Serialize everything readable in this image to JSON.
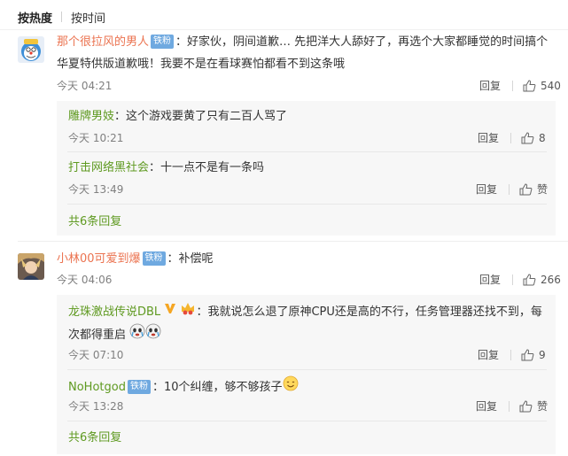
{
  "sort": {
    "hot": "按热度",
    "time": "按时间"
  },
  "comments": [
    {
      "user": "那个很拉风的男人",
      "badge": "铁粉",
      "text_line1": "：好家伙，阴间道歉… 先把洋大人舔好了，再选个大家都睡觉的时间搞个",
      "text_line2": "华夏特供版道歉哦！我要不是在看球赛怕都看不到这条哦",
      "time": "今天 04:21",
      "reply_label": "回复",
      "likes": "540",
      "replies": [
        {
          "user": "雕牌男妓",
          "text": "：这个游戏要黄了只有二百人骂了",
          "time": "今天 10:21",
          "reply_label": "回复",
          "likes": "8"
        },
        {
          "user": "打击网络黑社会",
          "text": "：十一点不是有一条吗",
          "time": "今天 13:49",
          "reply_label": "回复",
          "likes": "赞"
        }
      ],
      "more": "共6条回复"
    },
    {
      "user": "小林00可爱到爆",
      "badge": "铁粉",
      "text_line1": "：补偿呢",
      "time": "今天 04:06",
      "reply_label": "回复",
      "likes": "266",
      "replies": [
        {
          "user": "龙珠激战传说DBL",
          "text_line1": "：我就说怎么退了原神CPU还是高的不行，任务管理器还找不到，每",
          "text_line2": "次都得重启",
          "time": "今天 07:10",
          "reply_label": "回复",
          "likes": "9"
        },
        {
          "user": "NoHotgod",
          "badge": "铁粉",
          "text": "：10个纠缠，够不够孩子",
          "time": "今天 13:28",
          "reply_label": "回复",
          "likes": "赞"
        }
      ],
      "more": "共6条回复"
    }
  ],
  "colors": {
    "username": "#eb7350",
    "reply_username": "#5f9a21",
    "badge": "#6fa9e0",
    "reply_bg": "#f7f7f7"
  },
  "icons": [
    "thumbs-up-icon",
    "verified-v-icon",
    "crown-icon",
    "crying-face-icon",
    "smiling-face-icon"
  ]
}
